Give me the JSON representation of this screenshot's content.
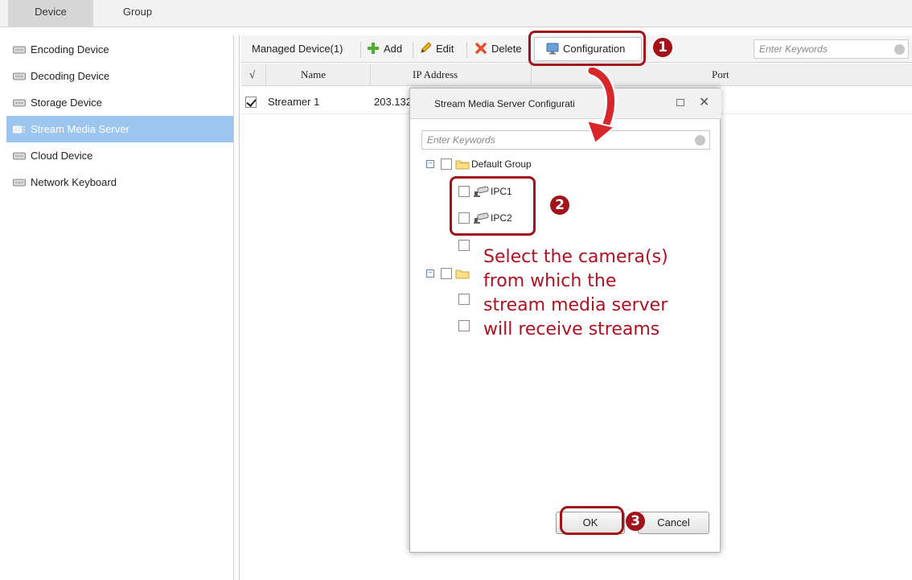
{
  "top_tabs": [
    {
      "label": "Device"
    },
    {
      "label": "Group"
    }
  ],
  "sidebar": {
    "items": [
      {
        "label": "Encoding Device",
        "icon": "device-icon"
      },
      {
        "label": "Decoding Device",
        "icon": "device-icon"
      },
      {
        "label": "Storage Device",
        "icon": "device-icon"
      },
      {
        "label": "Stream Media Server",
        "icon": "server-icon",
        "active": true
      },
      {
        "label": "Cloud Device",
        "icon": "device-icon"
      },
      {
        "label": "Network Keyboard",
        "icon": "device-icon"
      }
    ]
  },
  "toolbar": {
    "managed_label": "Managed Device(1)",
    "add_label": "Add",
    "edit_label": "Edit",
    "delete_label": "Delete",
    "configuration_label": "Configuration",
    "search_placeholder": "Enter Keywords"
  },
  "table": {
    "headers": {
      "check": "√",
      "name": "Name",
      "ip": "IP Address",
      "port": "Port"
    },
    "rows": [
      {
        "checked": true,
        "name": "Streamer 1",
        "ip": "203.132"
      }
    ]
  },
  "dialog": {
    "title": "Stream Media Server Configurati",
    "search_placeholder": "Enter Keywords",
    "tree": {
      "group_label": "Default Group",
      "cameras": [
        {
          "label": "IPC1"
        },
        {
          "label": "IPC2"
        }
      ]
    },
    "ok_label": "OK",
    "cancel_label": "Cancel"
  },
  "annotations": {
    "steps": [
      "1",
      "2",
      "3"
    ],
    "instruction": "Select the camera(s) from which the stream media server will receive streams"
  },
  "colors": {
    "accent_red": "#a11219",
    "sidebar_active": "#9cc6ee"
  }
}
